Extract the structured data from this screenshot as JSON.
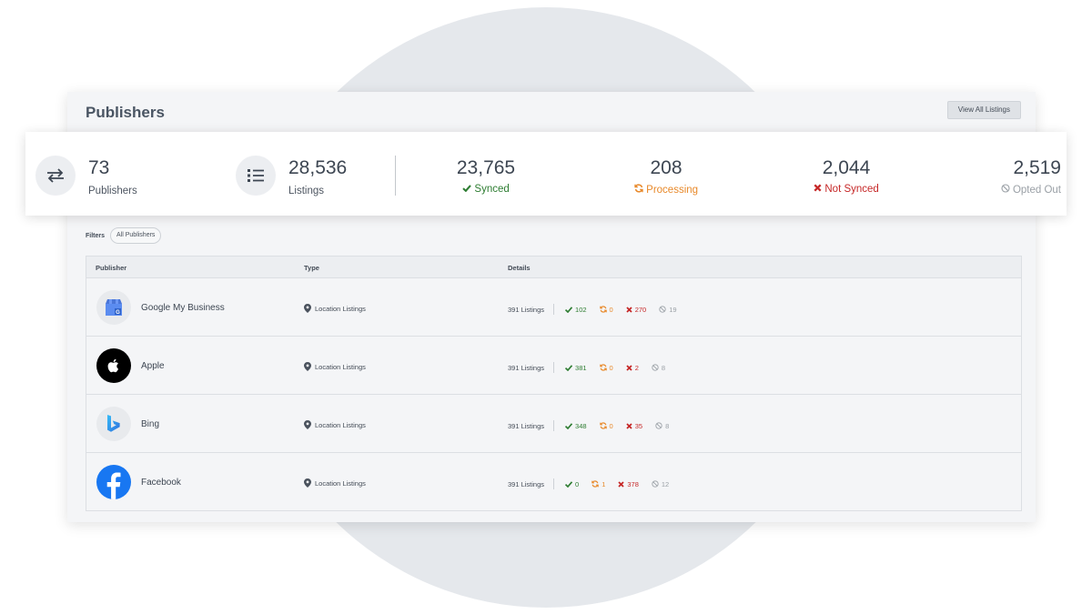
{
  "card": {
    "title": "Publishers",
    "view_all_label": "View All Listings"
  },
  "stats": {
    "publishers": {
      "value": "73",
      "label": "Publishers"
    },
    "listings": {
      "value": "28,536",
      "label": "Listings"
    },
    "synced": {
      "value": "23,765",
      "label": "Synced"
    },
    "processing": {
      "value": "208",
      "label": "Processing"
    },
    "not_synced": {
      "value": "2,044",
      "label": "Not Synced"
    },
    "opted_out": {
      "value": "2,519",
      "label": "Opted Out"
    }
  },
  "filters": {
    "label": "Filters",
    "chip": "All Publishers"
  },
  "table": {
    "headers": {
      "publisher": "Publisher",
      "type": "Type",
      "details": "Details"
    },
    "rows": [
      {
        "name": "Google My Business",
        "type": "Location Listings",
        "listings": "391 Listings",
        "synced": "102",
        "processing": "0",
        "not_synced": "270",
        "opted_out": "19"
      },
      {
        "name": "Apple",
        "type": "Location Listings",
        "listings": "391 Listings",
        "synced": "381",
        "processing": "0",
        "not_synced": "2",
        "opted_out": "8"
      },
      {
        "name": "Bing",
        "type": "Location Listings",
        "listings": "391 Listings",
        "synced": "348",
        "processing": "0",
        "not_synced": "35",
        "opted_out": "8"
      },
      {
        "name": "Facebook",
        "type": "Location Listings",
        "listings": "391 Listings",
        "synced": "0",
        "processing": "1",
        "not_synced": "378",
        "opted_out": "12"
      }
    ]
  },
  "colors": {
    "synced": "#2e7d32",
    "processing": "#e8892a",
    "not_synced": "#c62828",
    "opted_out": "#9aa0a6",
    "facebook_blue": "#1877f2",
    "bing_blue": "#2f6fdc"
  },
  "icons": {
    "publishers": "sync-arrows-icon",
    "listings": "list-icon",
    "synced": "check-icon",
    "processing": "refresh-icon",
    "not_synced": "x-icon",
    "opted_out": "ban-icon",
    "type": "map-pin-icon"
  }
}
